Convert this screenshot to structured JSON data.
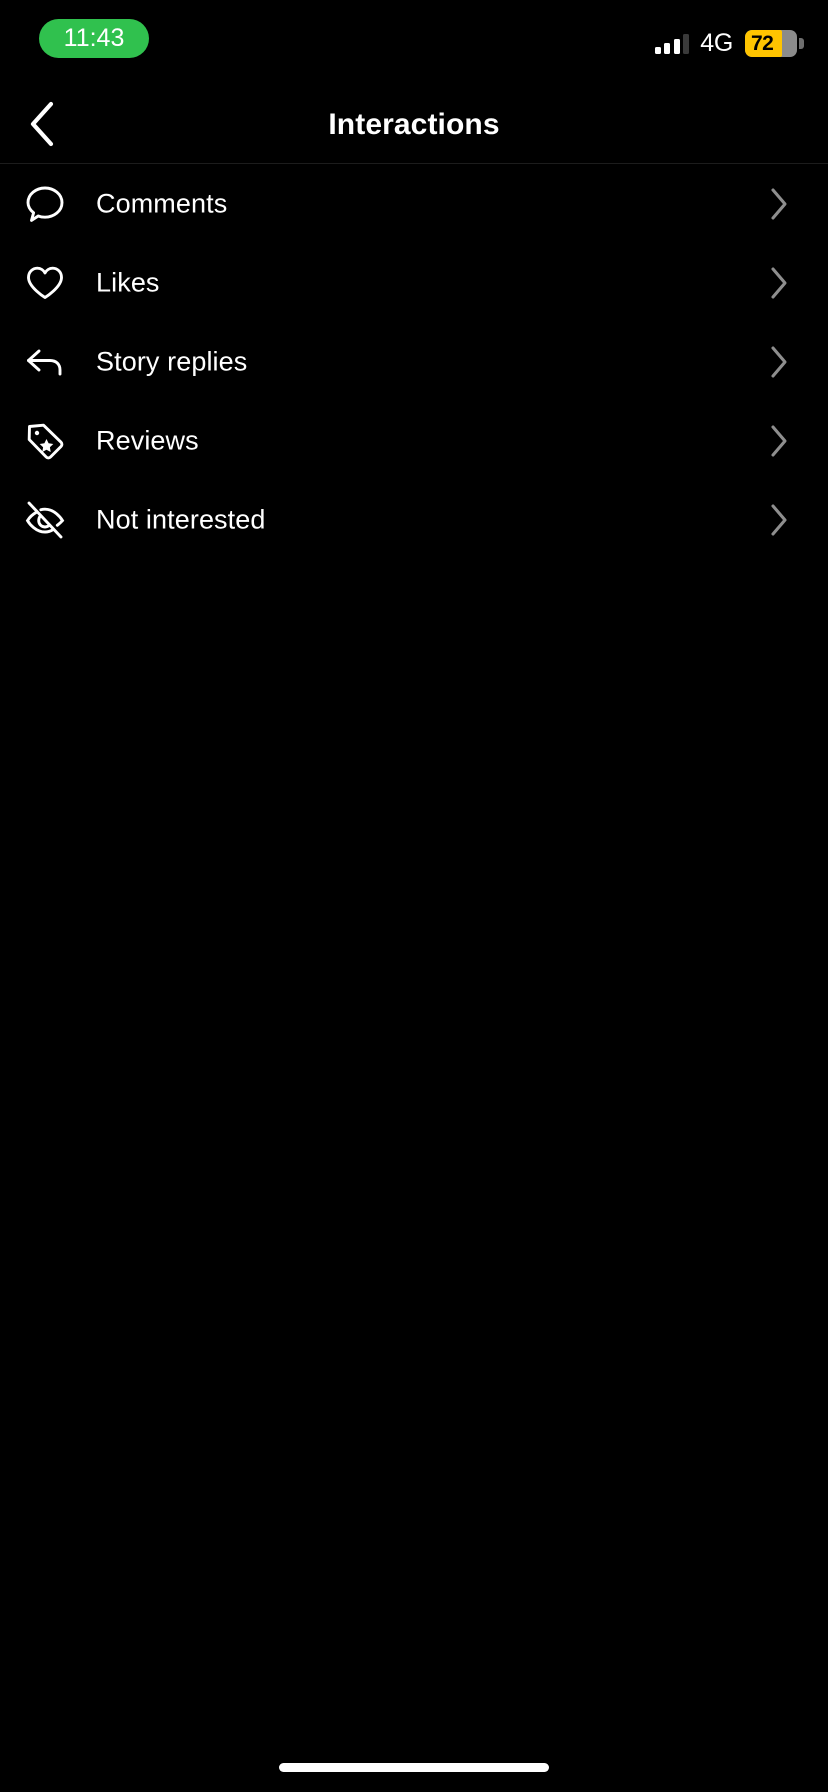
{
  "status_bar": {
    "time": "11:43",
    "time_pill_color": "#30C14E",
    "carrier_network": "4G",
    "battery_percent": "72",
    "battery_color": "#FFC400",
    "signal_bars_filled": 3,
    "signal_bars_total": 4
  },
  "header": {
    "title": "Interactions",
    "back_icon": "chevron-left-icon"
  },
  "list": {
    "items": [
      {
        "label": "Comments",
        "icon": "comment-bubble-icon",
        "chevron": "chevron-right-icon"
      },
      {
        "label": "Likes",
        "icon": "heart-icon",
        "chevron": "chevron-right-icon"
      },
      {
        "label": "Story replies",
        "icon": "reply-arrow-icon",
        "chevron": "chevron-right-icon"
      },
      {
        "label": "Reviews",
        "icon": "tag-star-icon",
        "chevron": "chevron-right-icon"
      },
      {
        "label": "Not interested",
        "icon": "eye-slash-icon",
        "chevron": "chevron-right-icon"
      }
    ]
  },
  "system": {
    "home_indicator": "home-indicator-bar"
  },
  "colors": {
    "background": "#000000",
    "text_primary": "#ffffff",
    "divider": "#1c1c1c",
    "chevron": "#8e8e8e"
  }
}
